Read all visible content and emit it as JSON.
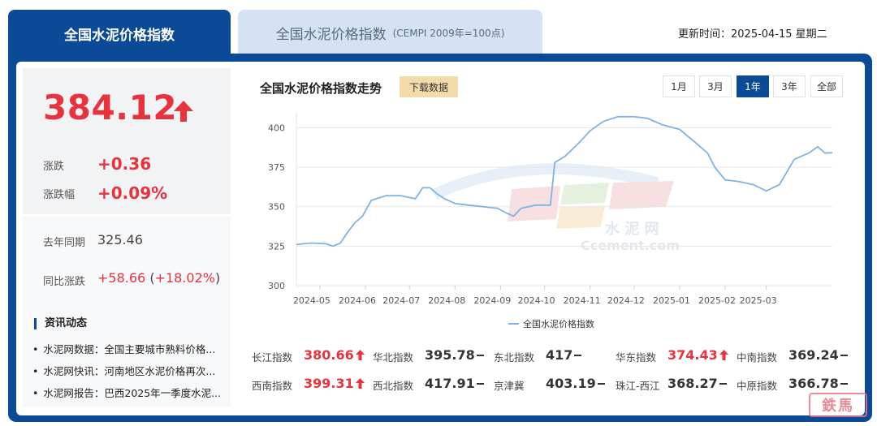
{
  "tabs": {
    "active_label": "全国水泥价格指数",
    "inactive_label": "全国水泥价格指数",
    "inactive_sub": "(CEMPI 2009年=100点)"
  },
  "update_time": "更新时间：2025-04-15 星期二",
  "summary": {
    "value": "384.12",
    "change_label": "涨跌",
    "change_value": "+0.36",
    "pct_label": "涨跌幅",
    "pct_value": "+0.09%",
    "last_year_label": "去年同期",
    "last_year_value": "325.46",
    "yoy_label": "同比涨跌",
    "yoy_value": "+58.66",
    "yoy_pct": "(+18.02%)"
  },
  "news": {
    "title": "资讯动态",
    "items": [
      "水泥网数据：全国主要城市熟料价格...",
      "水泥网快讯：河南地区水泥价格再次...",
      "水泥网报告：巴西2025年一季度水泥..."
    ]
  },
  "chart_header": {
    "title": "全国水泥价格指数走势",
    "download_label": "下载数据",
    "ranges": [
      "1月",
      "3月",
      "1年",
      "3年",
      "全部"
    ],
    "active_range": "1年"
  },
  "chart_data": {
    "type": "line",
    "title": "",
    "xlabel": "",
    "ylabel": "",
    "ylim": [
      300,
      410
    ],
    "yticks": [
      300,
      325,
      350,
      375,
      400
    ],
    "xticks": [
      "2024-05",
      "2024-06",
      "2024-07",
      "2024-08",
      "2024-09",
      "2024-10",
      "2024-11",
      "2024-12",
      "2025-01",
      "2025-02",
      "2025-03"
    ],
    "grid": true,
    "legend_position": "bottom",
    "series": [
      {
        "name": "全国水泥价格指数",
        "color": "#7fb2e5",
        "x": [
          "2024-04-15",
          "2024-04-25",
          "2024-05-05",
          "2024-05-10",
          "2024-05-15",
          "2024-05-20",
          "2024-05-25",
          "2024-05-30",
          "2024-06-05",
          "2024-06-15",
          "2024-06-25",
          "2024-07-05",
          "2024-07-10",
          "2024-07-15",
          "2024-07-20",
          "2024-07-25",
          "2024-08-01",
          "2024-08-10",
          "2024-08-20",
          "2024-08-30",
          "2024-09-05",
          "2024-09-10",
          "2024-09-15",
          "2024-09-25",
          "2024-10-05",
          "2024-10-08",
          "2024-10-15",
          "2024-10-25",
          "2024-11-01",
          "2024-11-10",
          "2024-11-20",
          "2024-12-01",
          "2024-12-10",
          "2024-12-20",
          "2025-01-01",
          "2025-01-10",
          "2025-01-20",
          "2025-01-25",
          "2025-02-01",
          "2025-02-10",
          "2025-02-20",
          "2025-03-01",
          "2025-03-10",
          "2025-03-20",
          "2025-03-30",
          "2025-04-05",
          "2025-04-10",
          "2025-04-15"
        ],
        "values": [
          326,
          327,
          326.5,
          325,
          327,
          334,
          340,
          344,
          354,
          357,
          357,
          355,
          362,
          362,
          358,
          355,
          352,
          351,
          350,
          349,
          346,
          344,
          349,
          351,
          351,
          378,
          382,
          391,
          398,
          404,
          407,
          407,
          406,
          402,
          399,
          392,
          384,
          375,
          367,
          366,
          364,
          360,
          364,
          380,
          384,
          388,
          384,
          384.12
        ]
      }
    ]
  },
  "watermark": {
    "cn": "水 泥 网",
    "en": "Ccement.com"
  },
  "indices": [
    {
      "name": "长江指数",
      "value": "380.66",
      "trend": "up"
    },
    {
      "name": "华北指数",
      "value": "395.78",
      "trend": "flat"
    },
    {
      "name": "东北指数",
      "value": "417",
      "trend": "flat"
    },
    {
      "name": "华东指数",
      "value": "374.43",
      "trend": "up"
    },
    {
      "name": "中南指数",
      "value": "369.24",
      "trend": "flat"
    },
    {
      "name": "西南指数",
      "value": "399.31",
      "trend": "up"
    },
    {
      "name": "西北指数",
      "value": "417.91",
      "trend": "flat"
    },
    {
      "name": "京津冀",
      "value": "403.19",
      "trend": "flat"
    },
    {
      "name": "珠江-西江",
      "value": "368.27",
      "trend": "flat"
    },
    {
      "name": "中原指数",
      "value": "366.78",
      "trend": "flat"
    }
  ],
  "colors": {
    "brand": "#0a4a97",
    "up": "#e8323c",
    "line": "#7fb2e5",
    "download_bg": "#f2dba9"
  },
  "stamp": "鉄馬"
}
